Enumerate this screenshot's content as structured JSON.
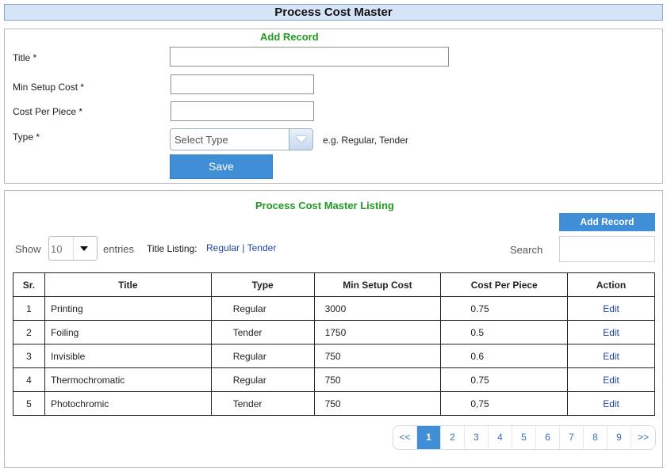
{
  "page": {
    "title": "Process Cost Master"
  },
  "form": {
    "heading": "Add Record",
    "title_label": "Title *",
    "min_setup_label": "Min Setup Cost *",
    "cost_per_piece_label": "Cost Per Piece *",
    "type_label": "Type *",
    "title_value": "",
    "min_setup_value": "",
    "cost_per_piece_value": "",
    "type_placeholder": "Select Type",
    "type_hint": "e.g. Regular, Tender",
    "save_label": "Save"
  },
  "listing": {
    "heading": "Process Cost Master Listing",
    "add_record_label": "Add Record",
    "show_label": "Show",
    "entries_value": "10",
    "entries_label": "entries",
    "title_listing_label": "Title Listing:",
    "filter_regular": "Regular",
    "filter_sep": "|",
    "filter_tender": "Tender",
    "search_label": "Search",
    "search_value": "",
    "columns": [
      "Sr.",
      "Title",
      "Type",
      "Min Setup Cost",
      "Cost Per Piece",
      "Action"
    ],
    "rows": [
      {
        "sr": "1",
        "title": "Printing",
        "type": "Regular",
        "min_setup": "3000",
        "cost": "0.75",
        "action": "Edit"
      },
      {
        "sr": "2",
        "title": "Foiling",
        "type": "Tender",
        "min_setup": "1750",
        "cost": "0.5",
        "action": "Edit"
      },
      {
        "sr": "3",
        "title": "Invisible",
        "type": "Regular",
        "min_setup": "750",
        "cost": "0.6",
        "action": "Edit"
      },
      {
        "sr": "4",
        "title": "Thermochromatic",
        "type": "Regular",
        "min_setup": "750",
        "cost": "0.75",
        "action": "Edit"
      },
      {
        "sr": "5",
        "title": "Photochromic",
        "type": "Tender",
        "min_setup": "750",
        "cost": "0,75",
        "action": "Edit"
      }
    ]
  },
  "pagination": {
    "prev": "<<",
    "pages": [
      "1",
      "2",
      "3",
      "4",
      "5",
      "6",
      "7",
      "8",
      "9"
    ],
    "next": ">>",
    "current": "1"
  },
  "colors": {
    "accent": "#3f8ed6",
    "heading_green": "#1f9a1f",
    "title_bar": "#d6e4f7",
    "link": "#1f45a8"
  }
}
